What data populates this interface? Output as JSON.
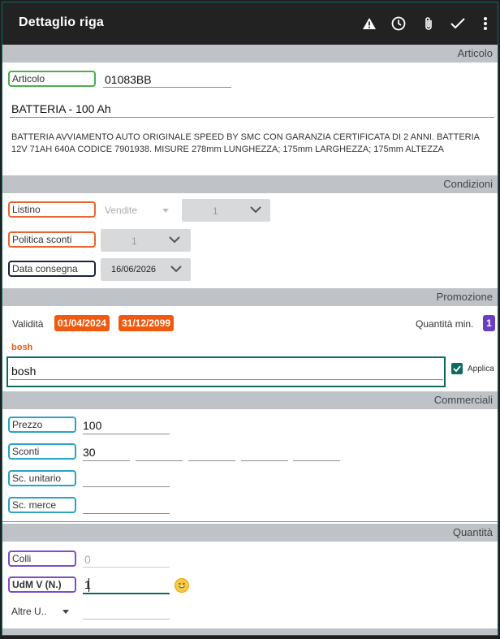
{
  "header": {
    "title": "Dettaglio riga"
  },
  "icons": {
    "warning": "warning-icon",
    "history": "clock-icon",
    "attach": "paperclip-icon",
    "confirm": "check-icon",
    "more": "more-vert-icon"
  },
  "sections": {
    "articolo": "Articolo",
    "condizioni": "Condizioni",
    "promozione": "Promozione",
    "commerciali": "Commerciali",
    "quantita": "Quantità"
  },
  "articolo": {
    "label": "Articolo",
    "code": "01083BB",
    "name": "BATTERIA - 100 Ah",
    "description": "BATTERIA AVVIAMENTO AUTO ORIGINALE SPEED BY SMC CON GARANZIA CERTIFICATA DI 2 ANNI. BATTERIA 12V 71AH 640A CODICE 7901938. MISURE 278mm LUNGHEZZA; 175mm LARGHEZZA; 175mm ALTEZZA"
  },
  "condizioni": {
    "listino_label": "Listino",
    "listino_value": "Vendite",
    "listino_num": "1",
    "politica_label": "Politica sconti",
    "politica_value": "1",
    "data_label": "Data consegna",
    "data_value": "16/06/2026"
  },
  "promozione": {
    "validita_label": "Validità",
    "date_from": "01/04/2024",
    "date_to": "31/12/2099",
    "qty_min_label": "Quantità min.",
    "qty_min_value": "1",
    "promo_name": "bosh",
    "promo_input": "bosh",
    "applica_label": "Applica",
    "applica_checked": true
  },
  "commerciali": {
    "prezzo_label": "Prezzo",
    "prezzo_value": "100",
    "sconti_label": "Sconti",
    "sconti_value": "30",
    "sc_unitario_label": "Sc. unitario",
    "sc_merce_label": "Sc. merce"
  },
  "quantita": {
    "colli_label": "Colli",
    "colli_value": "0",
    "udm_label": "UdM V (N.)",
    "udm_value": "1",
    "altre_label": "Altre U.."
  },
  "colors": {
    "topbar": "#222222",
    "section": "#bfc3c8",
    "green": "#4caf50",
    "orange": "#e8662e",
    "navy": "#1c2240",
    "teal": "#2aa3c4",
    "purple": "#7b4fc9",
    "promo_date_bg": "#f15a0e",
    "focus_border": "#0f6b62"
  }
}
